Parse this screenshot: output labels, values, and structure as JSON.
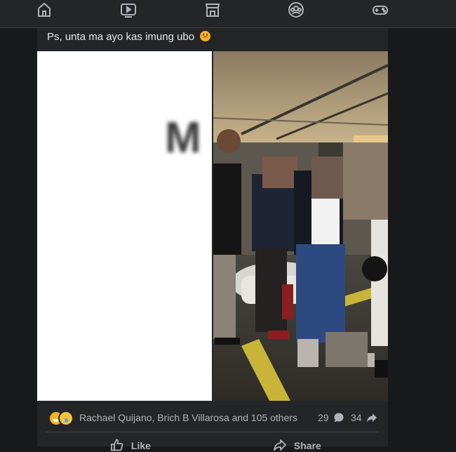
{
  "nav": {
    "items": [
      {
        "icon": "home-icon"
      },
      {
        "icon": "video-icon"
      },
      {
        "icon": "marketplace-icon"
      },
      {
        "icon": "groups-icon"
      },
      {
        "icon": "gaming-icon"
      }
    ]
  },
  "post": {
    "caption": "Ps, unta ma ayo kas imung ubo",
    "caption_emoji": "sad-face-emoji",
    "photo_left_text": "M",
    "reactions": {
      "icons": [
        "haha-icon",
        "sad-icon"
      ],
      "names": "Rachael Quijano, Brich B Villarosa and 105 others",
      "comments": "29",
      "shares": "34"
    },
    "actions": {
      "like": "Like",
      "share": "Share"
    }
  },
  "colors": {
    "background": "#18191a",
    "card": "#242526",
    "text": "#e4e6eb",
    "secondary_text": "#b0b3b8"
  }
}
